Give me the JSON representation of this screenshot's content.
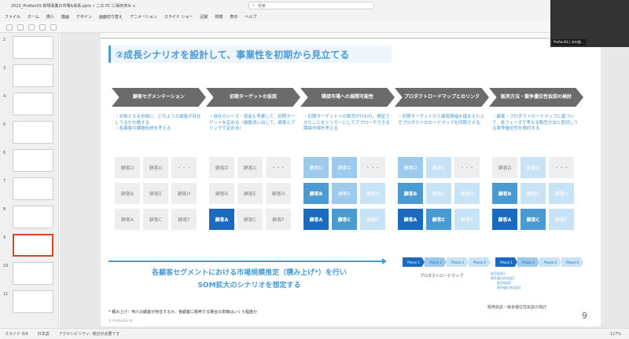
{
  "app": {
    "doc_title": "2023_ProfianSS 新規事業の市場&体系.pptx • この PC に保存済み ∨",
    "search_placeholder": "検索"
  },
  "menu": [
    "ファイル",
    "ホーム",
    "挿入",
    "描画",
    "デザイン",
    "画面切り替え",
    "アニメーション",
    "スライド ショー",
    "記録",
    "校閲",
    "表示",
    "ヘルプ"
  ],
  "thumbnails": [
    {
      "num": "2"
    },
    {
      "num": "3"
    },
    {
      "num": "4"
    },
    {
      "num": "5"
    },
    {
      "num": "6"
    },
    {
      "num": "7"
    },
    {
      "num": "8"
    },
    {
      "num": "9"
    },
    {
      "num": "10"
    },
    {
      "num": "11"
    }
  ],
  "webcam": {
    "label": "ProfianSS | 木村昌..."
  },
  "slide": {
    "title": "②成長シナリオを設計して、事業性を初期から見立てる",
    "steps": [
      {
        "label": "顧客セグメンテーション"
      },
      {
        "label": "初期ターゲットの仮説"
      },
      {
        "label": "隣接市場への展開可能性"
      },
      {
        "label": "プロダクトロードマップとのリンク"
      },
      {
        "label": "販売方法・競争優位性仮説の検討"
      }
    ],
    "descs": [
      "・対象となる市場に、どのような顧客が存在しうるか分類する\n・各顧客の課題仮説を考える",
      "・自社のシーズ・資産も考慮して、初期ターゲットを定める（複数洗い出して、顧客ヒアリングで定める）",
      "・初期ターゲットへの販売が行われ、検証できたことをトリガーにしてアプローチできる隣接市場を考える",
      "・初期ターゲットから顧客層幅を踏まえた上でプロダクトのロードマップを同期させる",
      "・顧客・プロダクトロードマップに基づいて、各フェーズで考える販売方法と差別しうる競争優位性を検討する"
    ],
    "grid_labels": [
      [
        "顧客D",
        "顧客G",
        "・・・"
      ],
      [
        "顧客B",
        "顧客E",
        "顧客H"
      ],
      [
        "顧客A",
        "顧客C",
        "顧客F"
      ]
    ],
    "grid_states": [
      [
        [
          0,
          0,
          0
        ],
        [
          0,
          0,
          0
        ],
        [
          0,
          0,
          0
        ]
      ],
      [
        [
          0,
          0,
          0
        ],
        [
          0,
          0,
          0
        ],
        [
          1,
          0,
          0
        ]
      ],
      [
        [
          3,
          3,
          0
        ],
        [
          2,
          3,
          4
        ],
        [
          1,
          2,
          4
        ]
      ],
      [
        [
          3,
          4,
          0
        ],
        [
          2,
          4,
          4
        ],
        [
          1,
          2,
          4
        ]
      ],
      [
        [
          0,
          4,
          0
        ],
        [
          2,
          4,
          4
        ],
        [
          1,
          2,
          4
        ]
      ]
    ],
    "summary_line1": "各顧客セグメントにおける市場規模推定（積み上げ*）を行い",
    "summary_line2": "SOM拡大のシナリオを想定する",
    "phases": [
      "Phase 1",
      "Phase 2",
      "Phase 3",
      "Phase 4"
    ],
    "roadmap_label": "プロダクトロードマップ",
    "phase_notes": [
      "販売仮説1",
      "競争優位性仮説1",
      "販売仮説2",
      "競争優位性仮説2"
    ],
    "sales_label": "販売仮説・競争優位性仮説の検討",
    "footnote": "* 積み上げ：何人の顧客が存在するか、各顧客に販売する場合の単価はいくら程度か",
    "copyright": "© ProfianSS Inc.",
    "page_number": "9"
  },
  "status": {
    "slide_info": "スライド 9/9",
    "language": "日本語",
    "accessibility": "アクセシビリティ: 検討が必要です",
    "zoom": "127%"
  }
}
